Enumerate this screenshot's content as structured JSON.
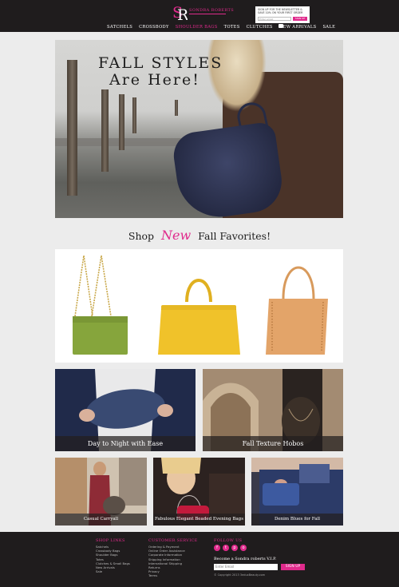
{
  "brand": {
    "name": "SONDRA ROBERTS",
    "colors": {
      "accent": "#e02a8c",
      "dark": "#1f1c1d",
      "background": "#ececec"
    },
    "logo_icon": "sr-monogram-icon"
  },
  "signup": {
    "text": "SIGN UP FOR THE NEWSLETTER & SAVE 10% ON YOUR FIRST ORDER",
    "placeholder": "Enter email",
    "button_label": "SIGN UP"
  },
  "top_icons": [
    "account-icon",
    "email-icon",
    "cart-icon"
  ],
  "nav": {
    "items": [
      {
        "label": "SATCHELS",
        "active": false
      },
      {
        "label": "CROSSBODY",
        "active": false
      },
      {
        "label": "SHOULDER BAGS",
        "active": true
      },
      {
        "label": "TOTES",
        "active": false
      },
      {
        "label": "CLUTCHES",
        "active": false
      },
      {
        "label": "NEW ARRIVALS",
        "active": false
      },
      {
        "label": "SALE",
        "active": false
      }
    ]
  },
  "hero": {
    "line1": "FALL STYLES",
    "line2": "Are Here!"
  },
  "shop_new": {
    "prefix": "Shop",
    "new": "New",
    "suffix": "Fall Favorites!"
  },
  "products": [
    {
      "name": "green-chain-clutch",
      "color": "#86a53c"
    },
    {
      "name": "yellow-woven-satchel",
      "color": "#f0c22a"
    },
    {
      "name": "tan-studded-hobo",
      "color": "#e3a469"
    }
  ],
  "features_large": [
    {
      "caption": "Day to Night with Ease"
    },
    {
      "caption": "Fall Texture Hobos"
    }
  ],
  "features_small": [
    {
      "caption": "Casual Carryall"
    },
    {
      "caption": "Fabulous Elegant Beaded Evening Bags"
    },
    {
      "caption": "Denim Blues for Fall"
    }
  ],
  "footer": {
    "shop_links": {
      "heading": "SHOP LINKS",
      "items": [
        "Satchels",
        "Crossbody Bags",
        "Shoulder Bags",
        "Totes",
        "Clutches & Small Bags",
        "New Arrivals",
        "Sale"
      ]
    },
    "customer_service": {
      "heading": "CUSTOMER SERVICE",
      "items": [
        "Ordering & Payment",
        "Online Order Assistance",
        "Corporate Information",
        "Shipping Information",
        "International Shipping",
        "Returns",
        "Privacy",
        "Terms"
      ]
    },
    "follow": {
      "heading": "FOLLOW US",
      "icons": [
        "facebook-icon",
        "twitter-icon",
        "pinterest-icon",
        "instagram-icon"
      ],
      "icon_glyphs": [
        "f",
        "t",
        "p",
        "o"
      ]
    },
    "vip": {
      "label": "Become a Sondra roberts V.I.P.",
      "placeholder": "Enter Email",
      "button_label": "SIGN UP"
    },
    "copyright": "© Copyright 2013 3eduxBeauty.com"
  }
}
